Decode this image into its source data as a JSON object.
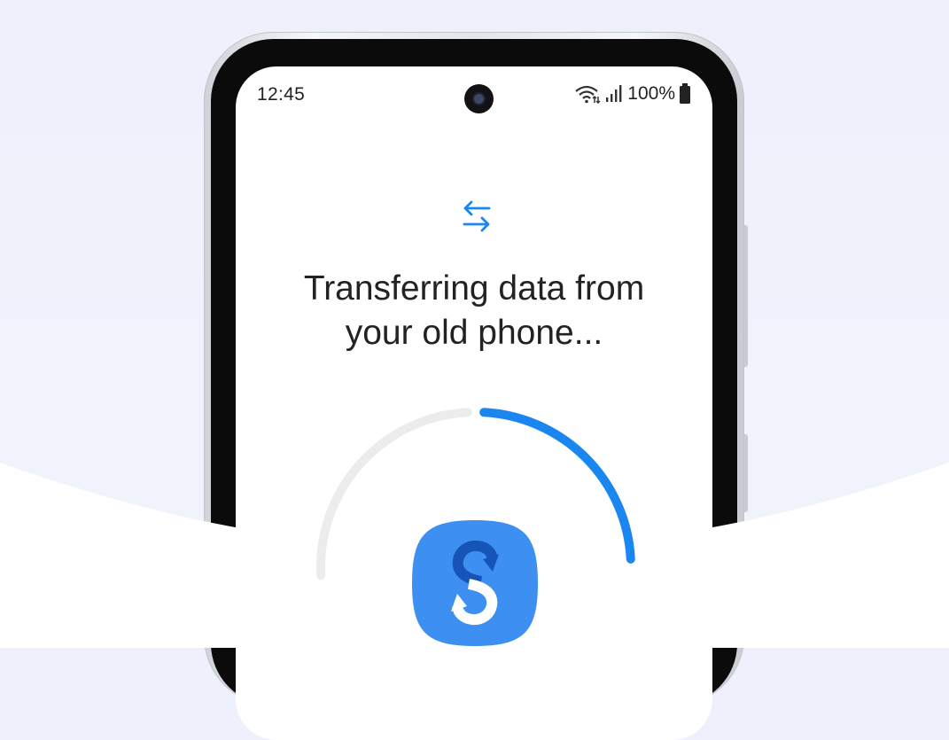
{
  "status_bar": {
    "time": "12:45",
    "battery_text": "100%",
    "icons": [
      "wifi-icon",
      "signal-icon",
      "battery-icon"
    ]
  },
  "transfer_icon": "swap-arrows-icon",
  "title_line1": "Transferring data from",
  "title_line2": "your old phone...",
  "progress": {
    "fraction": 0.5
  },
  "app_logo": "smart-switch-logo-icon",
  "colors": {
    "accent": "#1a86f0",
    "track": "#ececec",
    "logo_bg": "#3d8ff2",
    "logo_dark": "#1654b8"
  }
}
